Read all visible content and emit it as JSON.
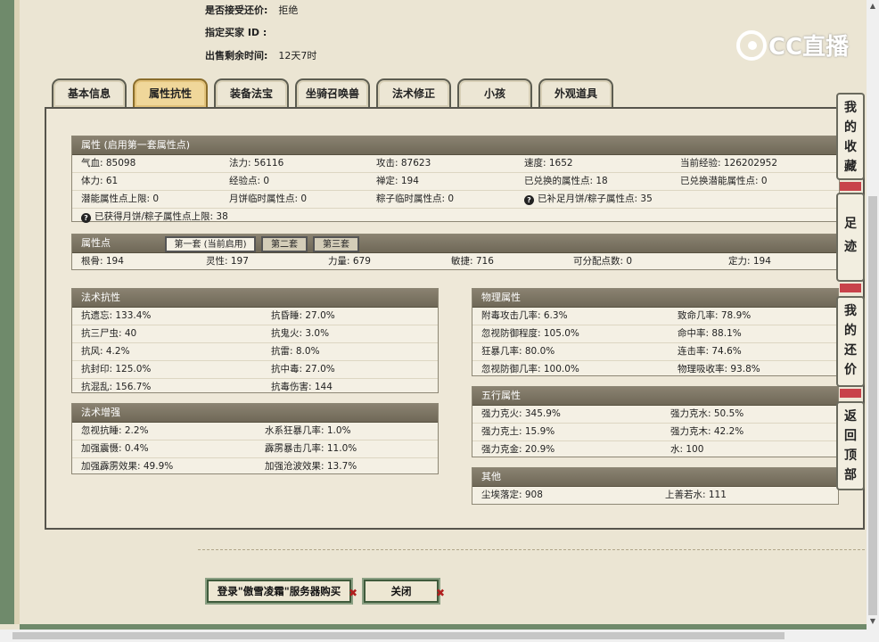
{
  "info": {
    "accept_bargain_label": "是否接受还价:",
    "accept_bargain_value": "拒绝",
    "buyer_label": "指定买家 ID :",
    "buyer_value": "",
    "remaining_label": "出售剩余时间:",
    "remaining_value": "12天7时"
  },
  "logo": {
    "text": "CC直播"
  },
  "tabs": [
    {
      "label": "基本信息"
    },
    {
      "label": "属性抗性"
    },
    {
      "label": "装备法宝"
    },
    {
      "label": "坐骑召唤兽"
    },
    {
      "label": "法术修正"
    },
    {
      "label": "小孩"
    },
    {
      "label": "外观道具"
    }
  ],
  "attributes": {
    "title": "属性 (启用第一套属性点)",
    "rows": [
      [
        "气血: 85098",
        "法力: 56116",
        "攻击: 87623",
        "速度: 1652",
        "当前经验: 126202952"
      ],
      [
        "体力: 61",
        "经验点: 0",
        "禅定: 194",
        "已兑换的属性点: 18",
        "已兑换潜能属性点: 0"
      ],
      [
        "潜能属性点上限: 0",
        "月饼临时属性点: 0",
        "粽子临时属性点: 0",
        "已补足月饼/粽子属性点: 35",
        ""
      ]
    ],
    "note": "已获得月饼/粽子属性点上限: 38"
  },
  "attr_points": {
    "title": "属性点",
    "subtabs": [
      "第一套 (当前启用)",
      "第二套",
      "第三套"
    ],
    "values": [
      "根骨: 194",
      "灵性: 197",
      "力量: 679",
      "敏捷: 716",
      "可分配点数: 0",
      "定力: 194"
    ]
  },
  "spell_resist": {
    "title": "法术抗性",
    "rows": [
      [
        "抗遗忘: 133.4%",
        "抗昏睡: 27.0%"
      ],
      [
        "抗三尸虫: 40",
        "抗鬼火: 3.0%"
      ],
      [
        "抗风: 4.2%",
        "抗雷: 8.0%"
      ],
      [
        "抗封印: 125.0%",
        "抗中毒: 27.0%"
      ],
      [
        "抗混乱: 156.7%",
        "抗毒伤害: 144"
      ]
    ]
  },
  "spell_boost": {
    "title": "法术增强",
    "rows": [
      [
        "忽视抗睡: 2.2%",
        "水系狂暴几率: 1.0%"
      ],
      [
        "加强震慑: 0.4%",
        "霹雳暴击几率: 11.0%"
      ],
      [
        "加强霹雳效果: 49.9%",
        "加强沧波效果: 13.7%"
      ]
    ]
  },
  "physical": {
    "title": "物理属性",
    "rows": [
      [
        "附毒攻击几率: 6.3%",
        "致命几率: 78.9%"
      ],
      [
        "忽视防御程度: 105.0%",
        "命中率: 88.1%"
      ],
      [
        "狂暴几率: 80.0%",
        "连击率: 74.6%"
      ],
      [
        "忽视防御几率: 100.0%",
        "物理吸收率: 93.8%"
      ]
    ]
  },
  "five_elements": {
    "title": "五行属性",
    "rows": [
      [
        "强力克火: 345.9%",
        "强力克水: 50.5%"
      ],
      [
        "强力克土: 15.9%",
        "强力克木: 42.2%"
      ],
      [
        "强力克金: 20.9%",
        "水: 100"
      ]
    ]
  },
  "other": {
    "title": "其他",
    "rows": [
      [
        "尘埃落定: 908",
        "上善若水: 111"
      ]
    ]
  },
  "buttons": {
    "login_label": "登录\"傲雪凌霜\"服务器购买",
    "close_label": "关闭"
  },
  "side": {
    "favorites": "我的收藏",
    "footprints": "足迹",
    "my_bargain": "我的还价",
    "back_top": "返回顶部"
  }
}
